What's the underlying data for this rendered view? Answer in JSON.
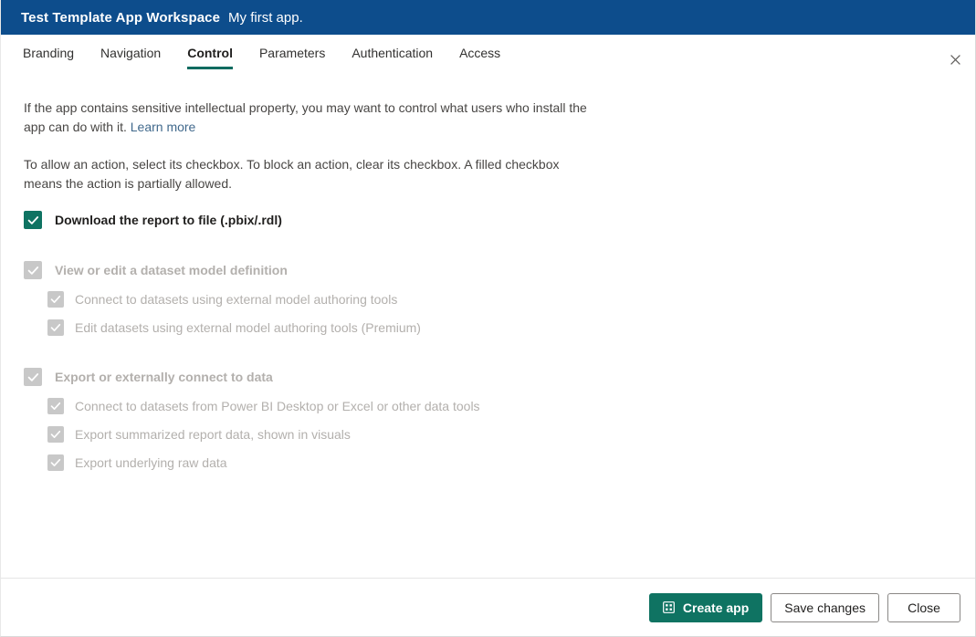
{
  "header": {
    "workspace_title": "Test Template App Workspace",
    "app_subtitle": "My first app.",
    "bg_color": "#0d4d8c"
  },
  "tabs": {
    "items": [
      {
        "label": "Branding",
        "active": false
      },
      {
        "label": "Navigation",
        "active": false
      },
      {
        "label": "Control",
        "active": true
      },
      {
        "label": "Parameters",
        "active": false
      },
      {
        "label": "Authentication",
        "active": false
      },
      {
        "label": "Access",
        "active": false
      }
    ],
    "active_underline_color": "#0f6b60",
    "close_icon": "close-icon"
  },
  "content": {
    "paragraph_1_prefix": "If the app contains sensitive intellectual property, you may want to control what users who install the app can do with it. ",
    "learn_more_label": "Learn more",
    "paragraph_2": "To allow an action, select its checkbox. To block an action, clear its checkbox. A filled checkbox means the action is partially allowed.",
    "checkboxes": [
      {
        "label": "Download the report to file (.pbix/.rdl)",
        "state": "checked",
        "level": 1,
        "enabled": true
      },
      {
        "label": "View or edit a dataset model definition",
        "state": "checked",
        "level": 1,
        "enabled": false
      },
      {
        "label": "Connect to datasets using external model authoring tools",
        "state": "checked",
        "level": 2,
        "enabled": false
      },
      {
        "label": "Edit datasets using external model authoring tools (Premium)",
        "state": "checked",
        "level": 2,
        "enabled": false
      },
      {
        "label": "Export or externally connect to data",
        "state": "checked",
        "level": 1,
        "enabled": false
      },
      {
        "label": "Connect to datasets from Power BI Desktop or Excel or other data tools",
        "state": "checked",
        "level": 2,
        "enabled": false
      },
      {
        "label": "Export summarized report data, shown in visuals",
        "state": "checked",
        "level": 2,
        "enabled": false
      },
      {
        "label": "Export underlying raw data",
        "state": "checked",
        "level": 2,
        "enabled": false
      }
    ],
    "checked_color": "#0f7362",
    "disabled_color": "#c8c8c8"
  },
  "footer": {
    "create_app_label": "Create app",
    "create_app_icon": "app-grid-icon",
    "save_changes_label": "Save changes",
    "close_label": "Close",
    "primary_color": "#0f7362"
  }
}
